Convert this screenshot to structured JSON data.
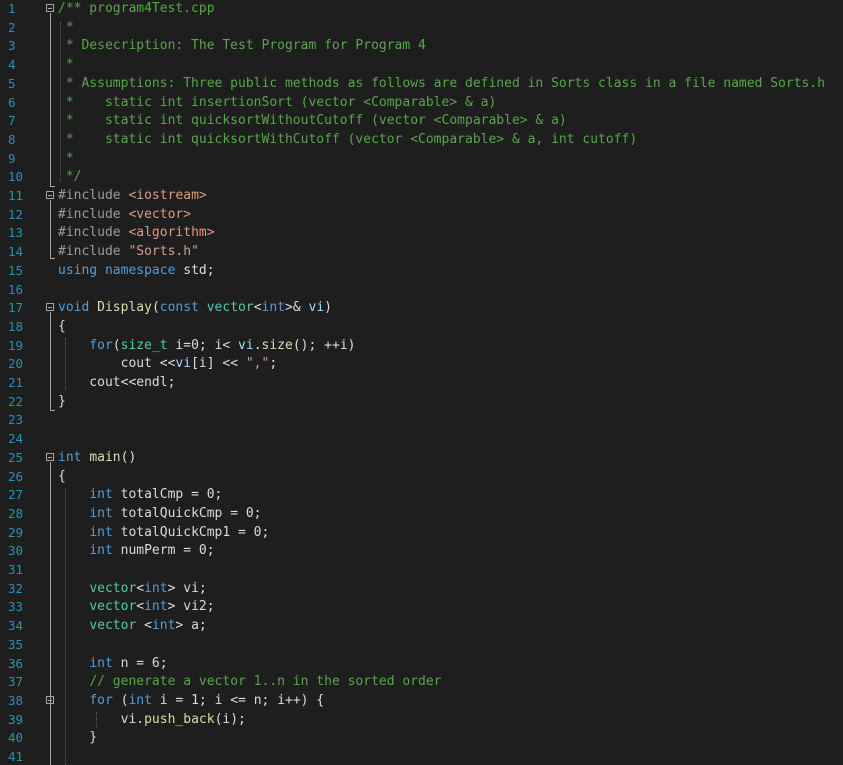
{
  "editor": {
    "lines": [
      {
        "n": "1",
        "fold": true,
        "tokens": [
          {
            "c": "c",
            "t": "/** program4Test.cpp"
          }
        ]
      },
      {
        "n": "2",
        "tokens": [
          {
            "c": "c",
            "t": " *"
          }
        ]
      },
      {
        "n": "3",
        "tokens": [
          {
            "c": "c",
            "t": " * Desecription: The Test Program for Program 4"
          }
        ]
      },
      {
        "n": "4",
        "tokens": [
          {
            "c": "c",
            "t": " *"
          }
        ]
      },
      {
        "n": "5",
        "tokens": [
          {
            "c": "c",
            "t": " * Assumptions: Three public methods as follows are defined in Sorts class in a file named Sorts.h"
          }
        ]
      },
      {
        "n": "6",
        "tokens": [
          {
            "c": "c",
            "t": " *    static int insertionSort (vector <Comparable> & a)"
          }
        ]
      },
      {
        "n": "7",
        "tokens": [
          {
            "c": "c",
            "t": " *    static int quicksortWithoutCutoff (vector <Comparable> & a)"
          }
        ]
      },
      {
        "n": "8",
        "tokens": [
          {
            "c": "c",
            "t": " *    static int quicksortWithCutoff (vector <Comparable> & a, int cutoff)"
          }
        ]
      },
      {
        "n": "9",
        "tokens": [
          {
            "c": "c",
            "t": " *"
          }
        ]
      },
      {
        "n": "10",
        "tokens": [
          {
            "c": "c",
            "t": " */"
          }
        ]
      },
      {
        "n": "11",
        "fold": true,
        "tokens": [
          {
            "c": "pp",
            "t": "#include "
          },
          {
            "c": "s",
            "t": "<iostream>"
          }
        ]
      },
      {
        "n": "12",
        "tokens": [
          {
            "c": "pp",
            "t": "#include "
          },
          {
            "c": "s",
            "t": "<vector>"
          }
        ]
      },
      {
        "n": "13",
        "tokens": [
          {
            "c": "pp",
            "t": "#include "
          },
          {
            "c": "s",
            "t": "<algorithm>"
          }
        ]
      },
      {
        "n": "14",
        "tokens": [
          {
            "c": "pp",
            "t": "#include "
          },
          {
            "c": "s",
            "t": "\"Sorts.h\""
          }
        ]
      },
      {
        "n": "15",
        "tokens": [
          {
            "c": "k",
            "t": "using"
          },
          {
            "c": "",
            "t": " "
          },
          {
            "c": "k",
            "t": "namespace"
          },
          {
            "c": "",
            "t": " std;"
          }
        ]
      },
      {
        "n": "16",
        "tokens": []
      },
      {
        "n": "17",
        "fold": true,
        "tokens": [
          {
            "c": "k",
            "t": "void"
          },
          {
            "c": "",
            "t": " "
          },
          {
            "c": "f",
            "t": "Display"
          },
          {
            "c": "",
            "t": "("
          },
          {
            "c": "k",
            "t": "const"
          },
          {
            "c": "",
            "t": " "
          },
          {
            "c": "t",
            "t": "vector"
          },
          {
            "c": "",
            "t": "<"
          },
          {
            "c": "k",
            "t": "int"
          },
          {
            "c": "",
            "t": ">& "
          },
          {
            "c": "v",
            "t": "vi"
          },
          {
            "c": "",
            "t": ")"
          }
        ]
      },
      {
        "n": "18",
        "tokens": [
          {
            "c": "",
            "t": "{"
          }
        ]
      },
      {
        "n": "19",
        "tokens": [
          {
            "c": "",
            "t": "    "
          },
          {
            "c": "k",
            "t": "for"
          },
          {
            "c": "",
            "t": "("
          },
          {
            "c": "t",
            "t": "size_t"
          },
          {
            "c": "",
            "t": " "
          },
          {
            "c": "vl",
            "t": "i"
          },
          {
            "c": "",
            "t": "=0; "
          },
          {
            "c": "vl",
            "t": "i"
          },
          {
            "c": "",
            "t": "< "
          },
          {
            "c": "v",
            "t": "vi"
          },
          {
            "c": "",
            "t": "."
          },
          {
            "c": "f",
            "t": "size"
          },
          {
            "c": "",
            "t": "(); ++"
          },
          {
            "c": "vl",
            "t": "i"
          },
          {
            "c": "",
            "t": ")"
          }
        ]
      },
      {
        "n": "20",
        "tokens": [
          {
            "c": "",
            "t": "        cout <<"
          },
          {
            "c": "v",
            "t": "vi"
          },
          {
            "c": "",
            "t": "["
          },
          {
            "c": "vl",
            "t": "i"
          },
          {
            "c": "",
            "t": "] << "
          },
          {
            "c": "s",
            "t": "\",\""
          },
          {
            "c": "",
            "t": ";"
          }
        ]
      },
      {
        "n": "21",
        "tokens": [
          {
            "c": "",
            "t": "    cout<<endl;"
          }
        ]
      },
      {
        "n": "22",
        "tokens": [
          {
            "c": "",
            "t": "}"
          }
        ]
      },
      {
        "n": "23",
        "tokens": []
      },
      {
        "n": "24",
        "tokens": []
      },
      {
        "n": "25",
        "fold": true,
        "tokens": [
          {
            "c": "k",
            "t": "int"
          },
          {
            "c": "",
            "t": " "
          },
          {
            "c": "f",
            "t": "main"
          },
          {
            "c": "",
            "t": "()"
          }
        ]
      },
      {
        "n": "26",
        "tokens": [
          {
            "c": "",
            "t": "{"
          }
        ]
      },
      {
        "n": "27",
        "tokens": [
          {
            "c": "",
            "t": "    "
          },
          {
            "c": "k",
            "t": "int"
          },
          {
            "c": "",
            "t": " "
          },
          {
            "c": "vl",
            "t": "totalCmp"
          },
          {
            "c": "",
            "t": " = 0;"
          }
        ]
      },
      {
        "n": "28",
        "tokens": [
          {
            "c": "",
            "t": "    "
          },
          {
            "c": "k",
            "t": "int"
          },
          {
            "c": "",
            "t": " "
          },
          {
            "c": "vl",
            "t": "totalQuickCmp"
          },
          {
            "c": "",
            "t": " = 0;"
          }
        ]
      },
      {
        "n": "29",
        "tokens": [
          {
            "c": "",
            "t": "    "
          },
          {
            "c": "k",
            "t": "int"
          },
          {
            "c": "",
            "t": " "
          },
          {
            "c": "vl",
            "t": "totalQuickCmp1"
          },
          {
            "c": "",
            "t": " = 0;"
          }
        ]
      },
      {
        "n": "30",
        "tokens": [
          {
            "c": "",
            "t": "    "
          },
          {
            "c": "k",
            "t": "int"
          },
          {
            "c": "",
            "t": " "
          },
          {
            "c": "vl",
            "t": "numPerm"
          },
          {
            "c": "",
            "t": " = 0;"
          }
        ]
      },
      {
        "n": "31",
        "tokens": []
      },
      {
        "n": "32",
        "tokens": [
          {
            "c": "",
            "t": "    "
          },
          {
            "c": "t",
            "t": "vector"
          },
          {
            "c": "",
            "t": "<"
          },
          {
            "c": "k",
            "t": "int"
          },
          {
            "c": "",
            "t": "> "
          },
          {
            "c": "vl",
            "t": "vi"
          },
          {
            "c": "",
            "t": ";"
          }
        ]
      },
      {
        "n": "33",
        "tokens": [
          {
            "c": "",
            "t": "    "
          },
          {
            "c": "t",
            "t": "vector"
          },
          {
            "c": "",
            "t": "<"
          },
          {
            "c": "k",
            "t": "int"
          },
          {
            "c": "",
            "t": "> "
          },
          {
            "c": "vl",
            "t": "vi2"
          },
          {
            "c": "",
            "t": ";"
          }
        ]
      },
      {
        "n": "34",
        "tokens": [
          {
            "c": "",
            "t": "    "
          },
          {
            "c": "t",
            "t": "vector"
          },
          {
            "c": "",
            "t": " <"
          },
          {
            "c": "k",
            "t": "int"
          },
          {
            "c": "",
            "t": "> "
          },
          {
            "c": "vl",
            "t": "a"
          },
          {
            "c": "",
            "t": ";"
          }
        ]
      },
      {
        "n": "35",
        "tokens": []
      },
      {
        "n": "36",
        "tokens": [
          {
            "c": "",
            "t": "    "
          },
          {
            "c": "k",
            "t": "int"
          },
          {
            "c": "",
            "t": " "
          },
          {
            "c": "vl",
            "t": "n"
          },
          {
            "c": "",
            "t": " = 6;"
          }
        ]
      },
      {
        "n": "37",
        "tokens": [
          {
            "c": "",
            "t": "    "
          },
          {
            "c": "c",
            "t": "// generate a vector 1..n in the sorted order"
          }
        ]
      },
      {
        "n": "38",
        "fold": true,
        "tokens": [
          {
            "c": "",
            "t": "    "
          },
          {
            "c": "k",
            "t": "for"
          },
          {
            "c": "",
            "t": " ("
          },
          {
            "c": "k",
            "t": "int"
          },
          {
            "c": "",
            "t": " "
          },
          {
            "c": "vl",
            "t": "i"
          },
          {
            "c": "",
            "t": " = 1; "
          },
          {
            "c": "vl",
            "t": "i"
          },
          {
            "c": "",
            "t": " <= "
          },
          {
            "c": "vl",
            "t": "n"
          },
          {
            "c": "",
            "t": "; "
          },
          {
            "c": "vl",
            "t": "i"
          },
          {
            "c": "",
            "t": "++) {"
          }
        ]
      },
      {
        "n": "39",
        "tokens": [
          {
            "c": "",
            "t": "        "
          },
          {
            "c": "vl",
            "t": "vi"
          },
          {
            "c": "",
            "t": "."
          },
          {
            "c": "f",
            "t": "push_back"
          },
          {
            "c": "",
            "t": "("
          },
          {
            "c": "vl",
            "t": "i"
          },
          {
            "c": "",
            "t": ");"
          }
        ]
      },
      {
        "n": "40",
        "tokens": [
          {
            "c": "",
            "t": "    }"
          }
        ]
      },
      {
        "n": "41",
        "tokens": []
      }
    ]
  }
}
